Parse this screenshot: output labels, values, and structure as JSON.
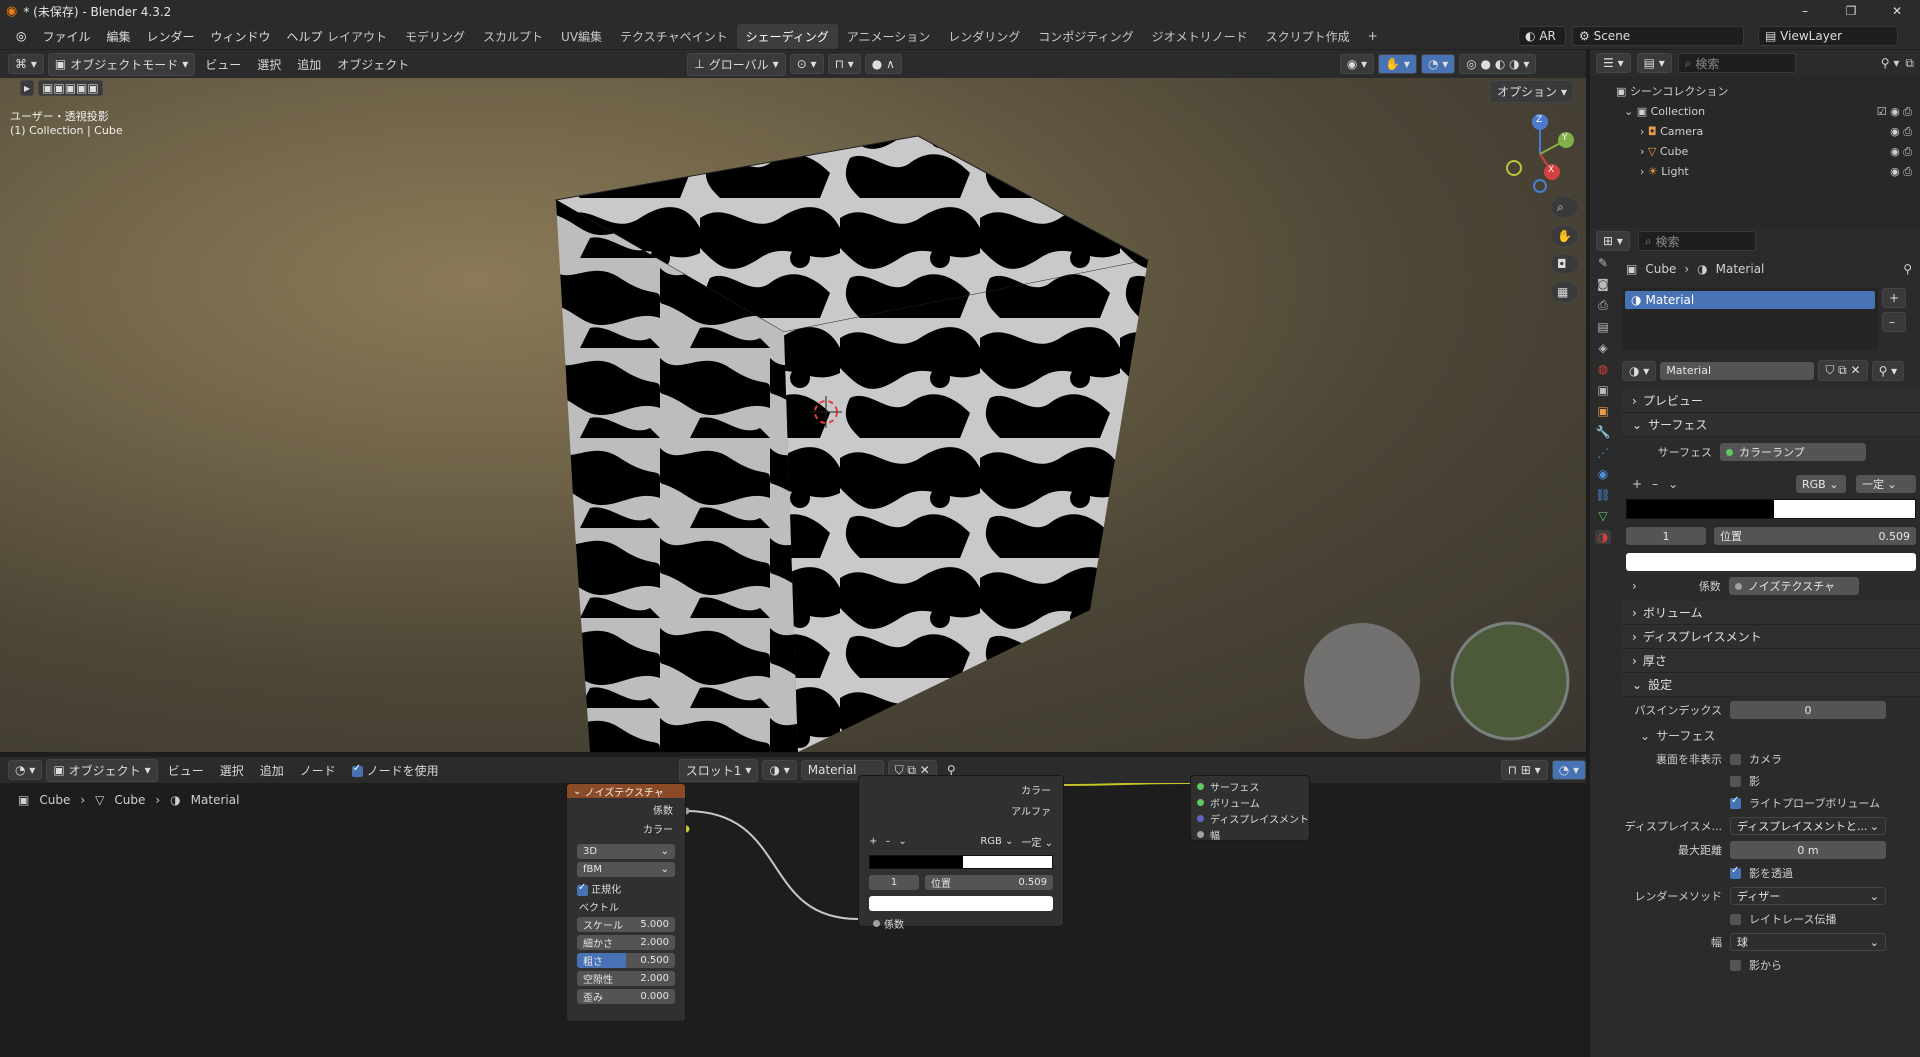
{
  "window": {
    "title": "* (未保存) - Blender 4.3.2",
    "controls": [
      "–",
      "❐",
      "✕"
    ]
  },
  "menubar": [
    "ファイル",
    "編集",
    "レンダー",
    "ウィンドウ",
    "ヘルプ"
  ],
  "workspaces": [
    "レイアウト",
    "モデリング",
    "スカルプト",
    "UV編集",
    "テクスチャペイント",
    "シェーディング",
    "アニメーション",
    "レンダリング",
    "コンポジティング",
    "ジオメトリノード",
    "スクリプト作成"
  ],
  "active_workspace": "シェーディング",
  "topright": {
    "ar": "AR",
    "scene": "Scene",
    "viewlayer": "ViewLayer"
  },
  "viewport_header": {
    "mode": "オブジェクトモード",
    "menus": [
      "ビュー",
      "選択",
      "追加",
      "オブジェクト"
    ],
    "transform": "グローバル",
    "options": "オプション"
  },
  "viewport": {
    "view_name": "ユーザー・透視投影",
    "collection_info": "(1) Collection | Cube",
    "axes": [
      "Z",
      "Y",
      "X"
    ]
  },
  "outliner": {
    "search_placeholder": "検索",
    "root": "シーンコレクション",
    "collection": "Collection",
    "items": [
      "Camera",
      "Cube",
      "Light"
    ]
  },
  "properties": {
    "search_placeholder": "検索",
    "breadcrumb": [
      "Cube",
      "Material"
    ],
    "slot": "Material",
    "material_name": "Material",
    "sections": {
      "preview": "プレビュー",
      "surface": "サーフェス",
      "volume": "ボリューム",
      "displacement": "ディスプレイスメント",
      "thickness": "厚さ",
      "settings": "設定"
    },
    "surface_label": "サーフェス",
    "surface_value": "カラーランプ",
    "ramp": {
      "color_mode": "RGB",
      "interp": "一定",
      "index": "1",
      "pos_label": "位置",
      "pos_value": "0.509",
      "stop_position": 0.509
    },
    "factor_label": "係数",
    "factor_value": "ノイズテクスチャ",
    "settings": {
      "pass_index_label": "パスインデックス",
      "pass_index": "0",
      "sub_surface": "サーフェス",
      "backface_label": "裏面を非表示",
      "camera": "カメラ",
      "shadow": "影",
      "lightprobe": "ライトプローブボリューム",
      "displacement_label": "ディスプレイスメ...",
      "displacement_value": "ディスプレイスメントと...",
      "maxdist_label": "最大距離",
      "maxdist": "0 m",
      "transparent_shadow": "影を透過",
      "render_method_label": "レンダーメソッド",
      "render_method": "ディザー",
      "raytrace": "レイトレース伝播",
      "width_label": "幅",
      "width_value": "球",
      "from_shadow": "影から"
    }
  },
  "node_header": {
    "editor": "オブジェクト",
    "menus": [
      "ビュー",
      "選択",
      "追加",
      "ノード"
    ],
    "use_nodes": "ノードを使用",
    "slot": "スロット1",
    "material": "Material"
  },
  "node_breadcrumb": [
    "Cube",
    "Cube",
    "Material"
  ],
  "noise_node": {
    "title": "ノイズテクスチャ",
    "out_fac": "係数",
    "out_color": "カラー",
    "dim": "3D",
    "type": "fBM",
    "normalize": "正規化",
    "vector": "ベクトル",
    "fields": [
      {
        "label": "スケール",
        "value": "5.000"
      },
      {
        "label": "細かさ",
        "value": "2.000"
      },
      {
        "label": "粗さ",
        "value": "0.500"
      },
      {
        "label": "空隙性",
        "value": "2.000"
      },
      {
        "label": "歪み",
        "value": "0.000"
      }
    ]
  },
  "ramp_node": {
    "out_color": "カラー",
    "out_alpha": "アルファ",
    "mode": "RGB",
    "interp": "一定",
    "index": "1",
    "pos_label": "位置",
    "pos_value": "0.509",
    "in_fac": "係数"
  },
  "output_node": {
    "inputs": [
      "サーフェス",
      "ボリューム",
      "ディスプレイスメント",
      "幅"
    ]
  },
  "colors": {
    "accent": "#4772b3",
    "node_header_tex": "#8a4b26",
    "link": "#c7c7c7",
    "link_color": "#c7c729"
  }
}
